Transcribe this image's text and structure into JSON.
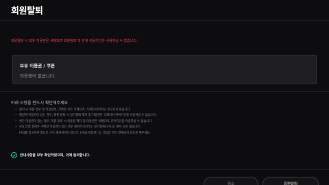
{
  "header": {
    "title": "회원탈퇴"
  },
  "warning_text": "회원탈퇴 시 보유 이용권은 삭제되며 회원정보 및 관계 이용기간은 사용하실 수 없습니다.",
  "holdings": {
    "title": "보유 이용권 / 쿠폰",
    "empty_text": "이용권이 없습니다."
  },
  "notice": {
    "title": "아래 사항을 반드시 확인해주세요",
    "items": [
      "탈퇴 시 회원 정보 및 이용정보, 기록은 모두 삭제되며, 삭제된 데이터는 복구되지 않습니다.",
      "월정액 이용권이 있는 경우, 회원 탈퇴 시 정기결제 해지 및 이용권은 삭제되며 잔여기간을 이용하실 수 없습니다.",
      "번든 이용권이 있는 경우, 회원 탈퇴 시 이용권 해지 및 이용권은 삭제되며, 잔여기간을 이용하실 수 없습니다.",
      "iOS 인앱 결제로 구매한 이용권이 있는 경우 탈퇴하시더라도 정기결제(구독)는 해지 되지 않습니다."
    ],
    "continuation": "FAQ를 참고하여 별도로 구독 해지하여야 합니다. [FAQ-이용권] Q. 다음달 부터 결제되지 않도록 해주세요."
  },
  "agree": {
    "label": "안내사항을 모두 확인하였으며, 이에 동의합니다."
  },
  "buttons": {
    "cancel_label": "취소",
    "withdraw_label": "회원탈퇴"
  },
  "colors": {
    "warning": "#ff3b5c",
    "accent": "#2bd4a7",
    "background": "#0d0d0f"
  }
}
